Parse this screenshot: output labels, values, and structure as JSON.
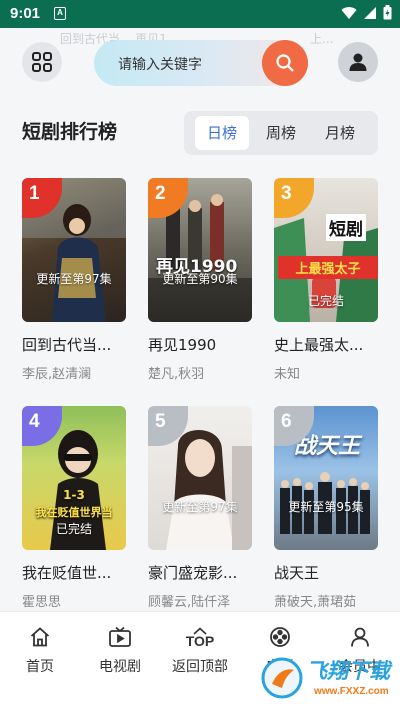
{
  "status": {
    "time": "9:01",
    "notif_letter": "A"
  },
  "header": {
    "search_placeholder": "请输入关键字",
    "ghost_left": "回到古代当...  再见1...",
    "ghost_right": "上..."
  },
  "section": {
    "title": "短剧排行榜",
    "tabs": [
      {
        "label": "日榜",
        "active": true
      },
      {
        "label": "周榜",
        "active": false
      },
      {
        "label": "月榜",
        "active": false
      }
    ]
  },
  "dramas": [
    {
      "rank": "1",
      "title": "回到古代当...",
      "cast": "李辰,赵清澜",
      "badge": "更新至第97集",
      "rank_color": "#e0312b"
    },
    {
      "rank": "2",
      "title": "再见1990",
      "cast": "楚凡,秋羽",
      "badge": "更新至第90集",
      "rank_color": "#f07b22"
    },
    {
      "rank": "3",
      "title": "史上最强太...",
      "cast": "未知",
      "badge": "已完结",
      "rank_color": "#f3a72a"
    },
    {
      "rank": "4",
      "title": "我在贬值世...",
      "cast": "霍思思",
      "badge": "已完结",
      "rank_color": "#7a6ee6"
    },
    {
      "rank": "5",
      "title": "豪门盛宠影...",
      "cast": "顾馨云,陆仟泽",
      "badge": "更新至第97集",
      "rank_color": "#b9bdc4"
    },
    {
      "rank": "6",
      "title": "战天王",
      "cast": "萧破天,萧珺茹",
      "badge": "更新至第95集",
      "rank_color": "#b9bdc4"
    }
  ],
  "poster_text": {
    "p2_title": "再见1990",
    "p3_title": "短剧",
    "p3_sub": "上最强太子",
    "p4_top": "1-3",
    "p4_mid": "我在贬值世界当",
    "p6_title": "战天王"
  },
  "bottom_nav": [
    {
      "label": "首页",
      "icon": "home-icon"
    },
    {
      "label": "电视剧",
      "icon": "tv-icon"
    },
    {
      "label": "返回顶部",
      "icon": "top-icon",
      "icon_text": "TOP"
    },
    {
      "label": "电影",
      "icon": "film-reel-icon"
    },
    {
      "label": "会员中",
      "icon": "user-icon"
    }
  ],
  "watermark": {
    "brand": "飞翔下载",
    "url": "www.FXXZ.com"
  },
  "colors": {
    "accent": "#3b6fd8",
    "search_button": "#f06a43",
    "status_bar": "#0b6e50"
  }
}
